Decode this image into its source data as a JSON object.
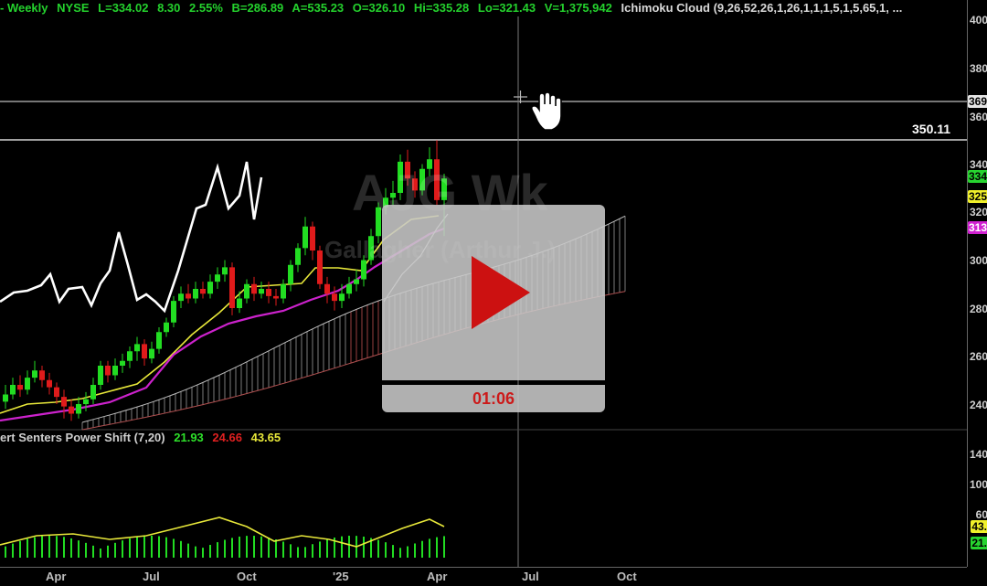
{
  "header": {
    "period": "- Weekly",
    "exchange": "NYSE",
    "last": "L=334.02",
    "change": "8.30",
    "change_pct": "2.55%",
    "b": "B=286.89",
    "a": "A=535.23",
    "open": "O=326.10",
    "high": "Hi=335.28",
    "low": "Lo=321.43",
    "volume": "V=1,375,942",
    "overlay": "Ichimoku Cloud (9,26,52,26,1,26,1,1,1,5,1,5,65,1, ..."
  },
  "price_axis": {
    "ticks": [
      "400",
      "380",
      "360",
      "340",
      "320",
      "300",
      "280",
      "260",
      "240"
    ],
    "badges": [
      {
        "text": "369",
        "bg": "#e6e6e6",
        "fg": "#000000"
      },
      {
        "text": "334",
        "bg": "#27d430",
        "fg": "#000000"
      },
      {
        "text": "325",
        "bg": "#f0f02a",
        "fg": "#000000"
      },
      {
        "text": "313",
        "bg": "#d020d0",
        "fg": "#ffffff"
      }
    ]
  },
  "indicator_axis": {
    "ticks": [
      "140",
      "100",
      "60"
    ],
    "badges": [
      {
        "text": "43.",
        "bg": "#f0f02a",
        "fg": "#000000"
      },
      {
        "text": "21.",
        "bg": "#27d430",
        "fg": "#000000"
      }
    ]
  },
  "level_label": "350.11",
  "watermark": {
    "line1": "AJG Wk",
    "line2": "Gallagher (Arthur J.)"
  },
  "indicator": {
    "name": "ert Senters Power Shift (7,20)",
    "v1": "21.93",
    "v2": "24.66",
    "v3": "43.65"
  },
  "x_axis": {
    "labels": [
      "Apr",
      "Jul",
      "Oct",
      "'25",
      "Apr",
      "Jul",
      "Oct"
    ]
  },
  "player": {
    "time": "01:06"
  },
  "colors": {
    "up": "#22dd22",
    "down": "#e01b1b",
    "yellow": "#e8e83a",
    "magenta": "#cc22cc",
    "line": "#ffffff"
  }
}
